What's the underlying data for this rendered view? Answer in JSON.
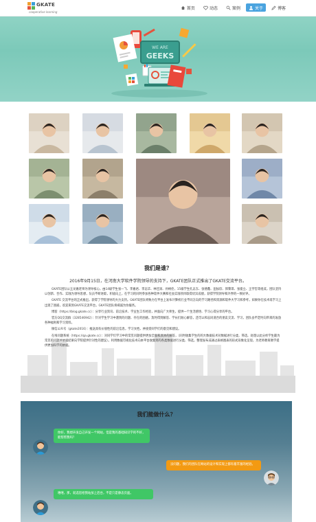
{
  "nav": {
    "logo_text": "GKATE",
    "logo_sub": "cooperative learning",
    "items": [
      {
        "label": "首页",
        "icon": "home-icon",
        "active": false
      },
      {
        "label": "动态",
        "icon": "heart-icon",
        "active": false
      },
      {
        "label": "案例",
        "icon": "search-icon",
        "active": false
      },
      {
        "label": "关于",
        "icon": "user-icon",
        "active": true
      },
      {
        "label": "博客",
        "icon": "pencil-icon",
        "active": false
      }
    ]
  },
  "hero": {
    "board_line1": "WE ARE",
    "board_line2": "GEEKS",
    "slides": 3,
    "active_slide": 2
  },
  "who": {
    "title": "我们是谁？",
    "lead": "2016年9月15日，在河南大学软件学院领导的支持下，GKATE团队正式推出了GKATE交流平台。",
    "paragraphs": [
      "GKATE团队以王龙嘉老师为领导核心，由14级学生张一飞、李嘉君、李志华、林佳润、孙柄伦，15级学生孔志东、张德鑫、田加欣、郭黎琪、张俊立、王宇哲等组成，团队坚持以创新、合作、实践为领导思想，队员不断进取，积极向上，在学习的同时参加各种软件大赛和社会实践项目取得优异成绩，获得学院领导和外界的一致好评。",
      "GKATE 交流平台的正式推出，获得了学院领导的大力支持。GKATE团队将致力在平台上发布计算机行业不同方向的学习路径和资源和软件大学习和参考，如果你在技术或学习上出现了困惑，欢迎来到GKATE交流平台，GKATE团队将竭诚为你服务。",
      "博客（https://blog.gkate.cc）：分享行业资讯、前沿技术、学业生工作经验，并面向广大师生，提供一个生活感悟、学习心得分享的平台。",
      "官方QQ交流群（328546942）：针对学生学习中遇到的问题、存在的困惑，及时得到解答、学长们耐心解答，还可以和志同道合的朋友交流、学习，团队会不定时向带来的发放各种福利和学习资料。",
      "微信公众号（gkate2016）：推送具有价值性的前沿信息，学习文档，并接受同学们的意见和建议。",
      "在线问题系统（https://qa.gkate.cc）：对同学们学习中的常见问题提供更加全面和具体的解答，（同时收集学生的的大数据技术对数据进行分类、筛选、处理以此分析学生最为常见的问题并依据结果向学院提供针对性的建议）。利用数据可视化技术向本平台收集到的各类数据进行分类、筛选，整理发布成通过表格图表的形式形象化呈现，为老师教育教学提供更加科学的依据。"
    ]
  },
  "what": {
    "title": "我们能做什么？",
    "messages": [
      {
        "side": "left",
        "color": "green",
        "text": "你好，我想开发自己开发一个网站，但是我的基础知识学的不好，能帮帮我吗？"
      },
      {
        "side": "right",
        "color": "orange",
        "text": "没问题，我们的团队在网站的设计和实现上都有着丰富的经验。"
      },
      {
        "side": "left",
        "color": "green",
        "text": "嘻嘻，那，就选您给我站加上后台，不是只是静态页面。"
      }
    ]
  },
  "colors": {
    "hero": "#7cc9b9",
    "nav_active": "#4aa3df",
    "bubble_green": "#40c766",
    "bubble_orange": "#f39a12",
    "what_bg": "#3c6f86"
  }
}
